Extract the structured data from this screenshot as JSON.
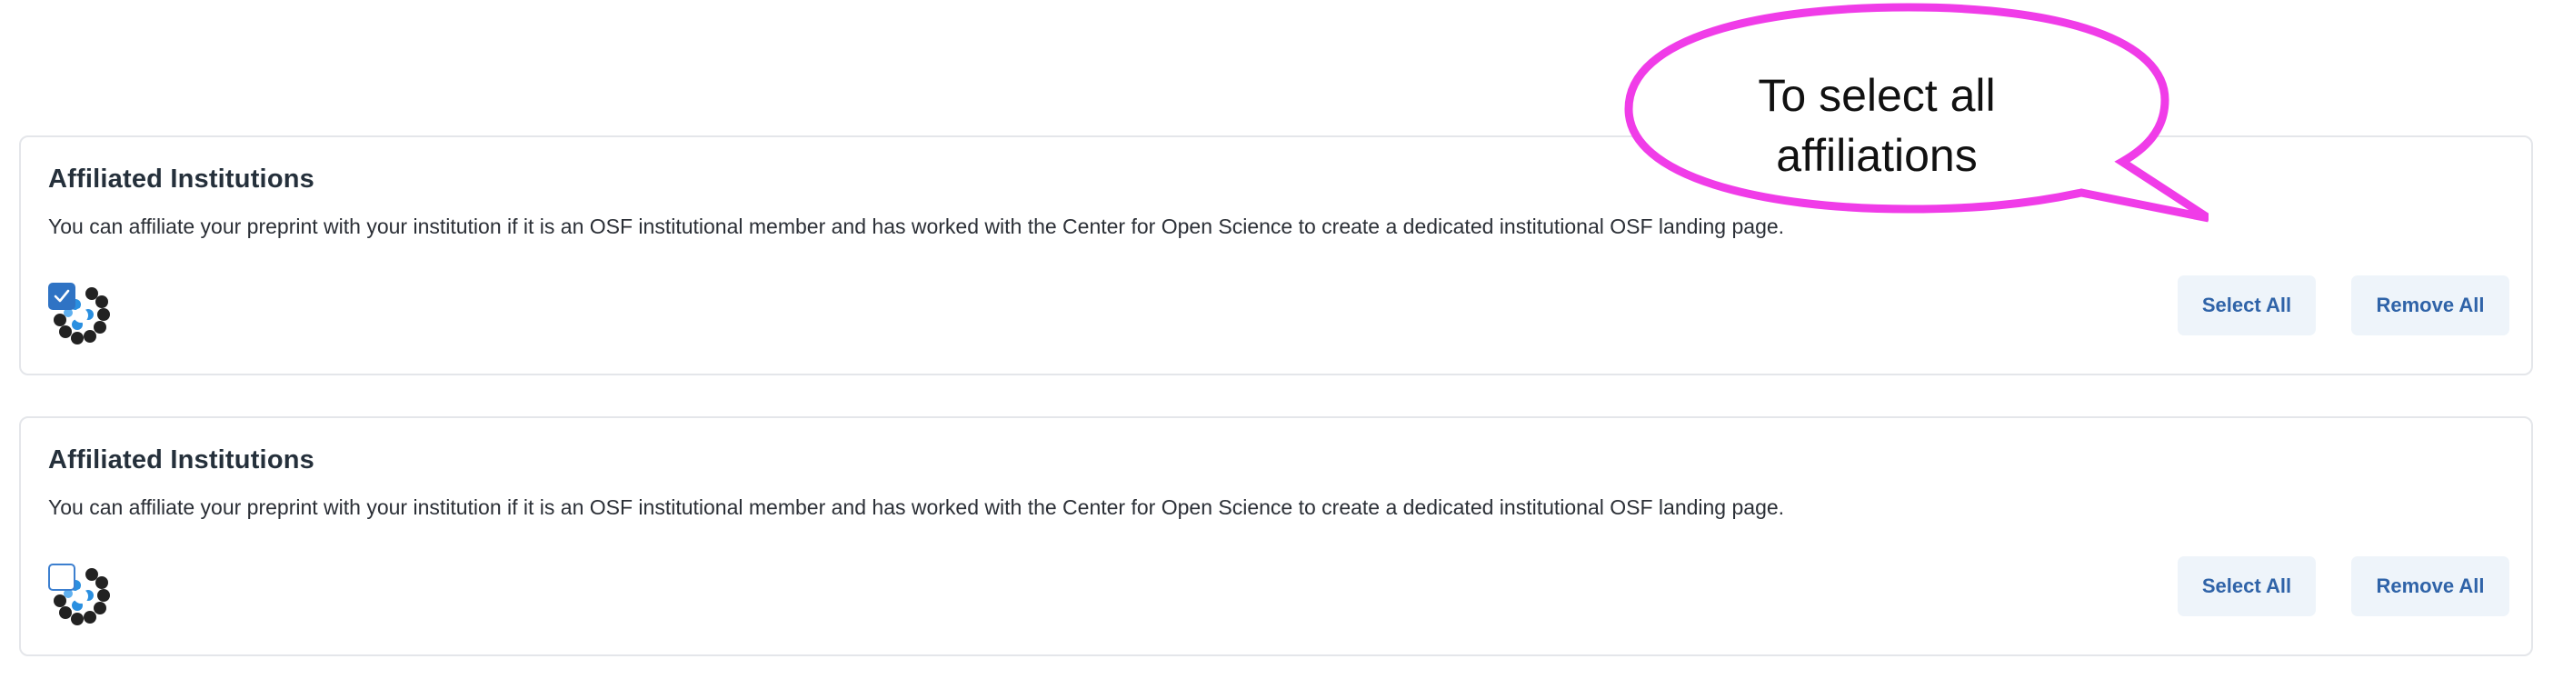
{
  "panels": [
    {
      "title": "Affiliated Institutions",
      "description": "You can affiliate your preprint with your institution if it is an OSF institutional member and has worked with the Center for Open Science to create a dedicated institutional OSF landing page.",
      "institution_checked": true,
      "select_all_label": "Select All",
      "remove_all_label": "Remove All"
    },
    {
      "title": "Affiliated Institutions",
      "description": "You can affiliate your preprint with your institution if it is an OSF institutional member and has worked with the Center for Open Science to create a dedicated institutional OSF landing page.",
      "institution_checked": false,
      "select_all_label": "Select All",
      "remove_all_label": "Remove All"
    }
  ],
  "annotation": {
    "text": "To select all affiliations",
    "stroke_color": "#f03ce8"
  },
  "colors": {
    "button_bg": "#eef4fa",
    "button_text": "#2f63a8",
    "checkbox_blue": "#2f73c4",
    "logo_dot_dark": "#222222",
    "logo_dot_blue": "#2a8fe0"
  },
  "icons": {
    "institution_logo": "institution-logo-icon",
    "checkmark": "checkmark-icon"
  }
}
